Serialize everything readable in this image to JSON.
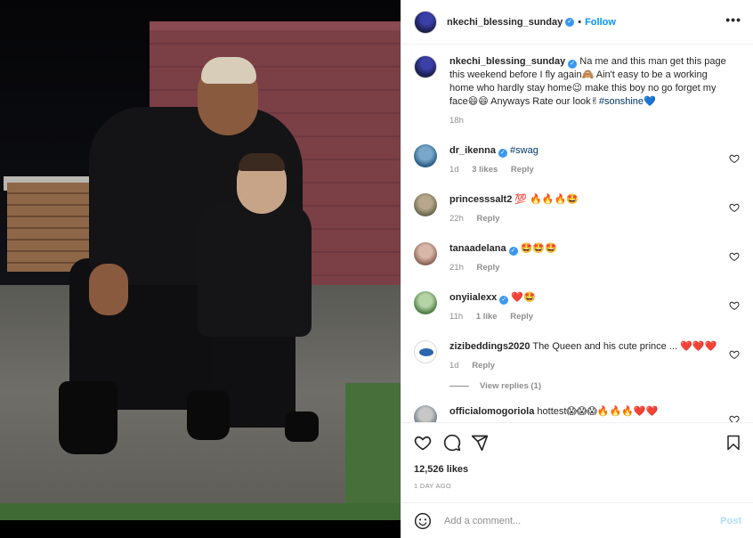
{
  "post": {
    "username": "nkechi_blessing_sunday",
    "follow_label": "Follow",
    "more_label": "•••",
    "caption_name": "nkechi_blessing_sunday",
    "caption_text": "Na me and this man get this page this weekend before I fly again🙈 Ain't easy to be a working home who hardly stay home😉 make this boy no go forget my face😄😄 Anyways Rate our look✌",
    "caption_tag": "#sonshine💙",
    "caption_time": "18h"
  },
  "comments": [
    {
      "name": "dr_ikenna",
      "verified": true,
      "text": "",
      "tag": "#swag",
      "time": "1d",
      "likes": "3 likes",
      "reply": "Reply"
    },
    {
      "name": "princesssalt2",
      "verified": false,
      "text": "💯 🔥🔥🔥🤩",
      "tag": "",
      "time": "22h",
      "likes": "",
      "reply": "Reply"
    },
    {
      "name": "tanaadelana",
      "verified": true,
      "text": "🤩🤩🤩",
      "tag": "",
      "time": "21h",
      "likes": "",
      "reply": "Reply"
    },
    {
      "name": "onyiialexx",
      "verified": true,
      "text": "❤️🤩",
      "tag": "",
      "time": "11h",
      "likes": "1 like",
      "reply": "Reply"
    },
    {
      "name": "zizibeddings2020",
      "verified": false,
      "text": "The Queen and his cute prince ... ❤️❤️❤️",
      "tag": "",
      "time": "1d",
      "likes": "",
      "reply": "Reply"
    },
    {
      "name": "officialomogoriola",
      "verified": false,
      "text": "hottest😱😱😱🔥🔥🔥❤️❤️",
      "tag": "",
      "time": "",
      "likes": "",
      "reply": ""
    }
  ],
  "view_replies": "View replies (1)",
  "footer": {
    "likes": "12,526 likes",
    "ago": "1 DAY AGO",
    "comment_placeholder": "Add a comment...",
    "post_label": "Post"
  },
  "icons": {
    "like": "heart-icon",
    "comment": "comment-icon",
    "share": "share-icon",
    "save": "bookmark-icon",
    "emoji": "emoji-icon",
    "verified": "verified-badge-icon",
    "more": "more-options-icon"
  }
}
